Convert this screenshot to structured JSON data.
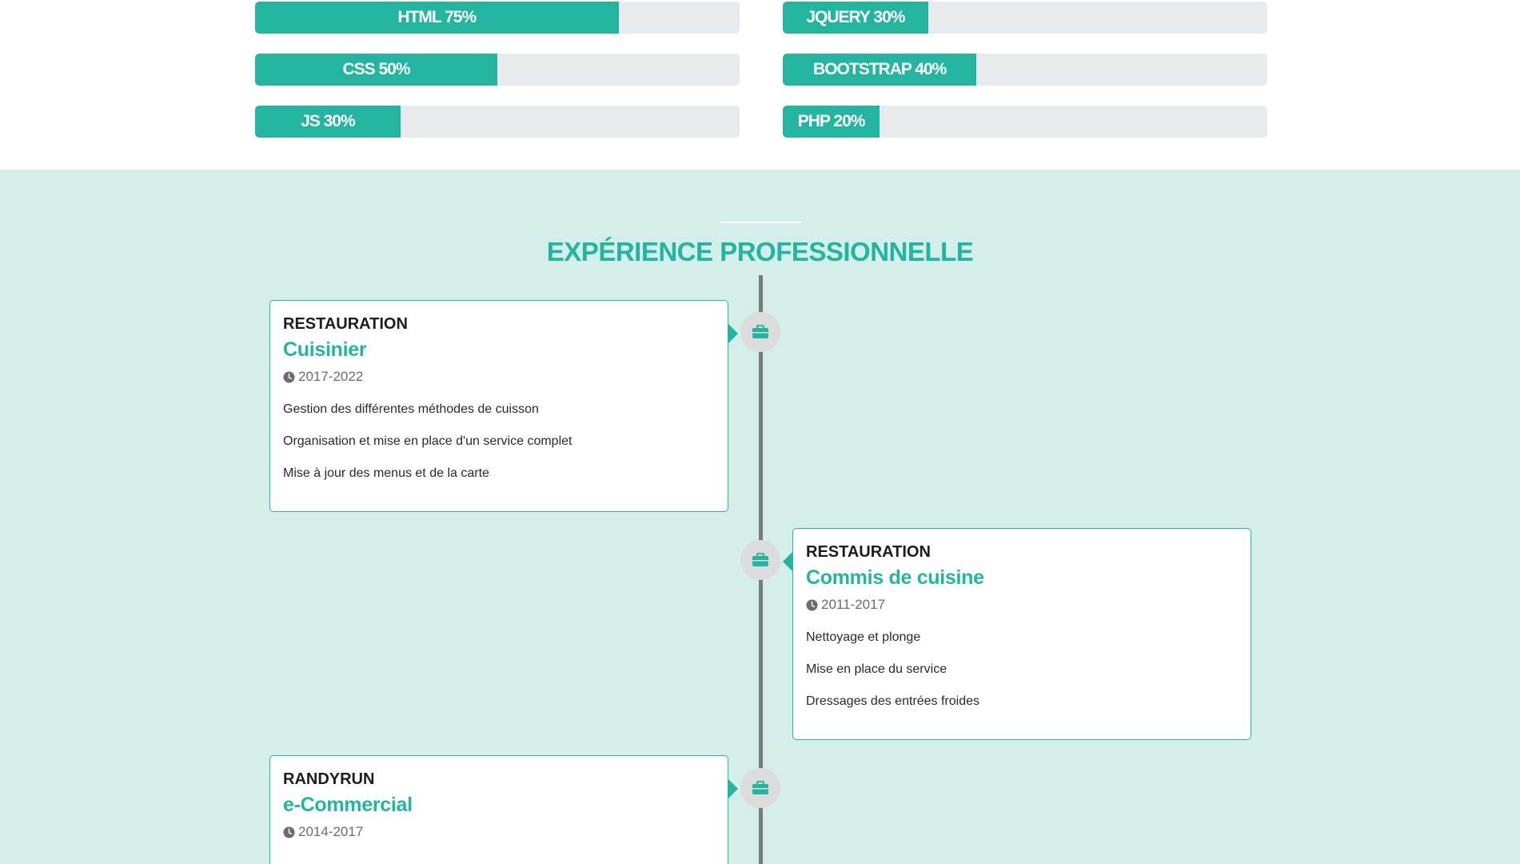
{
  "skills": {
    "left": [
      {
        "label": "HTML 75%",
        "percent": 75
      },
      {
        "label": "CSS 50%",
        "percent": 50
      },
      {
        "label": "JS 30%",
        "percent": 30
      }
    ],
    "right": [
      {
        "label": "JQUERY 30%",
        "percent": 30
      },
      {
        "label": "BOOTSTRAP 40%",
        "percent": 40
      },
      {
        "label": "PHP 20%",
        "percent": 20
      }
    ]
  },
  "experience": {
    "title": "EXPÉRIENCE PROFESSIONNELLE",
    "icon": "briefcase-icon",
    "items": [
      {
        "company": "RESTAURATION",
        "role": "Cuisinier",
        "period": "2017-2022",
        "tasks": [
          "Gestion des différentes méthodes de cuisson",
          "Organisation et mise en place d'un service complet",
          "Mise à jour des menus et de la carte"
        ]
      },
      {
        "company": "RESTAURATION",
        "role": "Commis de cuisine",
        "period": "2011-2017",
        "tasks": [
          "Nettoyage et plonge",
          "Mise en place du service",
          "Dressages des entrées froides"
        ]
      },
      {
        "company": "RANDYRUN",
        "role": "e-Commercial",
        "period": "2014-2017",
        "tasks": []
      }
    ]
  },
  "colors": {
    "accent": "#23b5a0",
    "section_bg": "#d4eeea",
    "bar_track": "#e8ebed",
    "timeline": "#7a7a7a"
  }
}
